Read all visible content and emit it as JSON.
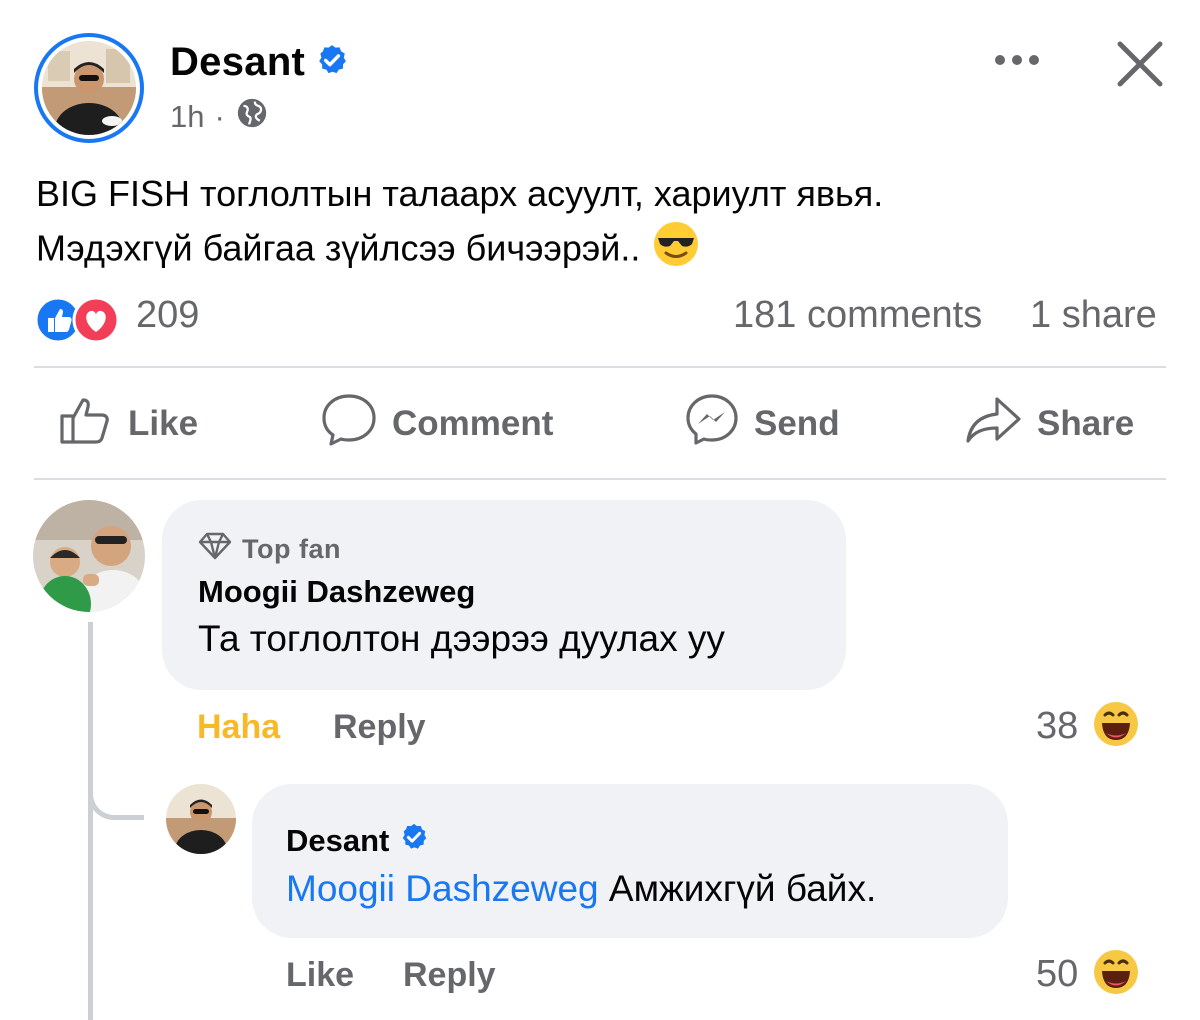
{
  "post": {
    "author": "Desant",
    "time": "1h",
    "separator": "·",
    "text_line1": "BIG FISH тоглолтын талаарх асуулт, хариулт явья.",
    "text_line2": "Мэдэхгүй байгаа зүйлсээ бичээрэй..",
    "reaction_count": "209",
    "comments": "181 comments",
    "shares": "1 share"
  },
  "actions": {
    "like": "Like",
    "comment": "Comment",
    "send": "Send",
    "share": "Share"
  },
  "comments": [
    {
      "badge": "Top fan",
      "author": "Moogii Dashzeweg",
      "text": "Та тоглолтон дээрээ дуулах уу",
      "reaction_label": "Haha",
      "reply_label": "Reply",
      "reaction_count": "38"
    },
    {
      "author": "Desant",
      "mention": "Moogii Dashzeweg",
      "text": "Амжихгүй байх.",
      "like_label": "Like",
      "reply_label": "Reply",
      "reaction_count": "50"
    }
  ],
  "colors": {
    "brand": "#1877f2",
    "haha": "#f7b928",
    "secondary_text": "#65676b",
    "bubble": "#f0f2f5"
  },
  "icons": [
    "verified-badge-icon",
    "globe-icon",
    "more-icon",
    "close-icon",
    "like-icon",
    "love-icon",
    "comment-icon",
    "messenger-icon",
    "share-icon",
    "diamond-icon",
    "haha-icon",
    "cool-emoji-icon"
  ]
}
